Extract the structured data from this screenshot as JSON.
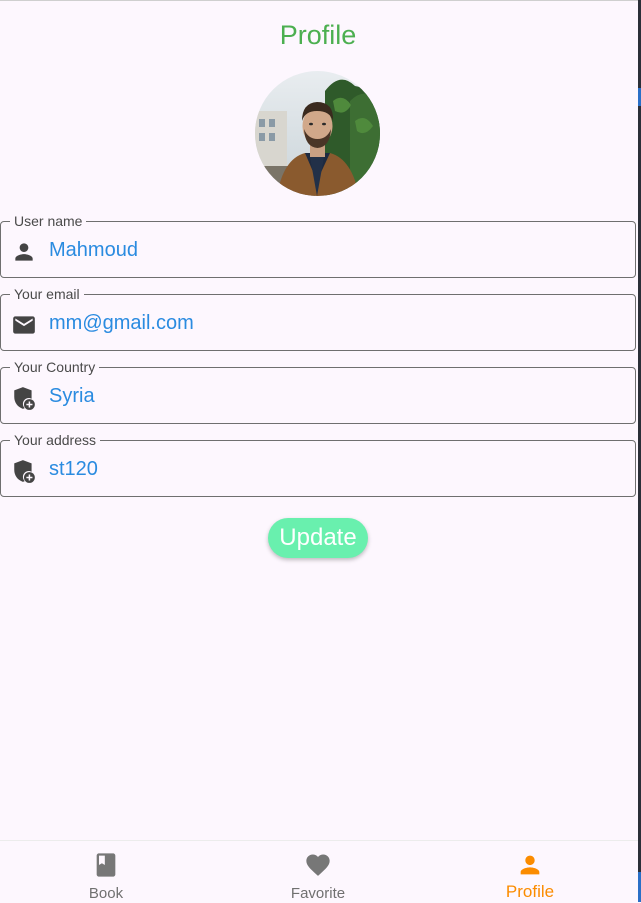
{
  "header": {
    "title": "Profile"
  },
  "profile": {
    "avatar_alt": "profile-photo",
    "fields": [
      {
        "label": "User name",
        "value": "Mahmoud",
        "icon": "person-icon"
      },
      {
        "label": "Your email",
        "value": "mm@gmail.com",
        "icon": "mail-icon"
      },
      {
        "label": "Your Country",
        "value": "Syria",
        "icon": "shield-add-icon"
      },
      {
        "label": "Your address",
        "value": "st120",
        "icon": "shield-add-icon"
      }
    ],
    "update_label": "Update"
  },
  "bottom_nav": {
    "items": [
      {
        "label": "Book",
        "icon": "book-icon",
        "active": false
      },
      {
        "label": "Favorite",
        "icon": "heart-icon",
        "active": false
      },
      {
        "label": "Profile",
        "icon": "person-icon",
        "active": true
      }
    ]
  },
  "colors": {
    "background": "#fdf7fe",
    "title": "#4caf50",
    "value_text": "#2a8be0",
    "button": "#69f0ae",
    "nav_active": "#fb8c00",
    "nav_inactive": "#707070",
    "icon": "#444444"
  }
}
